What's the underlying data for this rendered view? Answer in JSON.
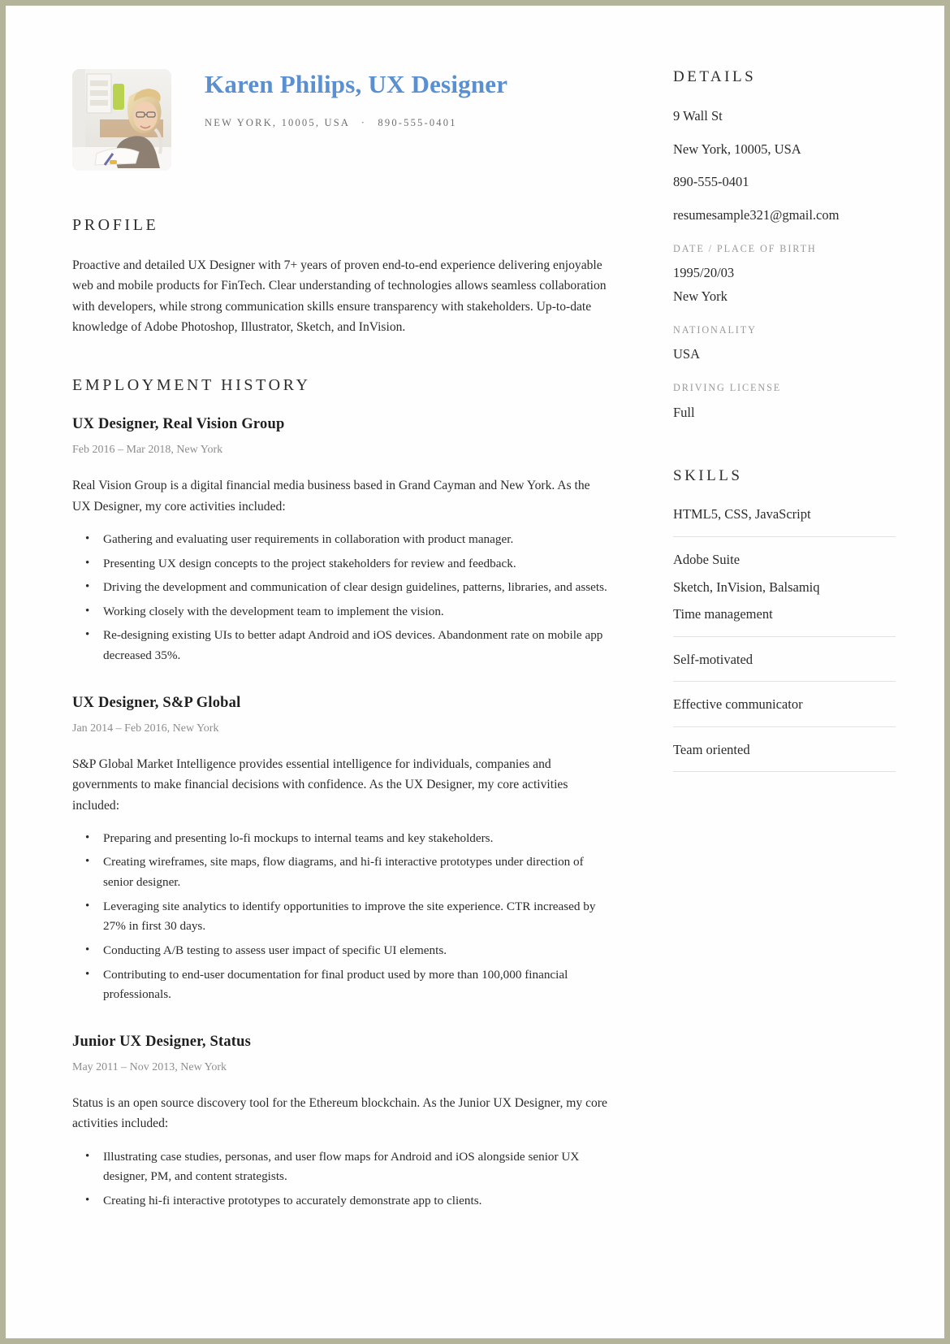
{
  "header": {
    "name": "Karen Philips, UX Designer",
    "location": "NEW YORK, 10005, USA",
    "separator": "·",
    "phone": "890-555-0401",
    "photo_alt": "portrait-photo",
    "accent_color": "#5a8fd0"
  },
  "profile": {
    "heading": "PROFILE",
    "text": "Proactive and detailed UX Designer with 7+ years of proven end-to-end experience delivering enjoyable web and mobile products for FinTech. Clear understanding of technologies allows seamless collaboration with developers, while strong communication skills ensure transparency with stakeholders. Up-to-date knowledge of Adobe Photoshop, Illustrator, Sketch, and InVision."
  },
  "employment": {
    "heading": "EMPLOYMENT HISTORY",
    "jobs": [
      {
        "title": "UX Designer, Real Vision Group",
        "meta": "Feb 2016 – Mar 2018, New York",
        "intro": "Real Vision Group is a digital financial media business based in Grand Cayman and New York. As the UX Designer, my core activities included:",
        "bullets": [
          "Gathering and evaluating user requirements in collaboration with product manager.",
          "Presenting UX design concepts to the project stakeholders for review and feedback.",
          "Driving the development and communication of clear design guidelines, patterns, libraries, and assets.",
          "Working closely with the development team to implement the vision.",
          "Re-designing existing UIs to better adapt Android and iOS devices. Abandonment rate on mobile app decreased 35%."
        ]
      },
      {
        "title": "UX Designer, S&P Global",
        "meta": "Jan 2014 – Feb 2016, New York",
        "intro": "S&P Global Market Intelligence provides essential intelligence for individuals, companies and governments to make financial decisions with confidence. As the UX Designer, my core activities included:",
        "bullets": [
          "Preparing and presenting lo-fi mockups to internal teams and key stakeholders.",
          "Creating wireframes, site maps, flow diagrams, and hi-fi interactive prototypes under direction of senior designer.",
          "Leveraging site analytics to identify opportunities to improve the site experience. CTR increased by 27% in first 30 days.",
          "Conducting A/B testing to assess user impact of specific UI elements.",
          "Contributing to end-user documentation for final product used by more than 100,000 financial professionals."
        ]
      },
      {
        "title": "Junior UX Designer, Status",
        "meta": "May 2011 – Nov 2013, New York",
        "intro": "Status is an open source discovery tool for the Ethereum blockchain. As the Junior UX Designer, my core activities included:",
        "bullets": [
          "Illustrating case studies, personas, and user flow maps for Android and iOS alongside senior UX designer, PM, and content strategists.",
          "Creating hi-fi interactive prototypes to accurately demonstrate app to clients."
        ]
      }
    ]
  },
  "details": {
    "heading": "DETAILS",
    "street": "9 Wall St",
    "city": "New York, 10005, USA",
    "phone": "890-555-0401",
    "email": "resumesample321@gmail.com",
    "dob_label": "DATE / PLACE OF BIRTH",
    "dob_date": "1995/20/03",
    "dob_place": "New York",
    "nationality_label": "NATIONALITY",
    "nationality_value": "USA",
    "driving_label": "DRIVING LICENSE",
    "driving_value": "Full"
  },
  "skills": {
    "heading": "SKILLS",
    "groups": [
      {
        "lines": [
          "HTML5, CSS, JavaScript"
        ]
      },
      {
        "lines": [
          "Adobe Suite",
          "Sketch, InVision, Balsamiq",
          "Time management"
        ]
      },
      {
        "lines": [
          "Self-motivated"
        ]
      },
      {
        "lines": [
          "Effective communicator"
        ]
      },
      {
        "lines": [
          "Team oriented"
        ]
      }
    ]
  }
}
